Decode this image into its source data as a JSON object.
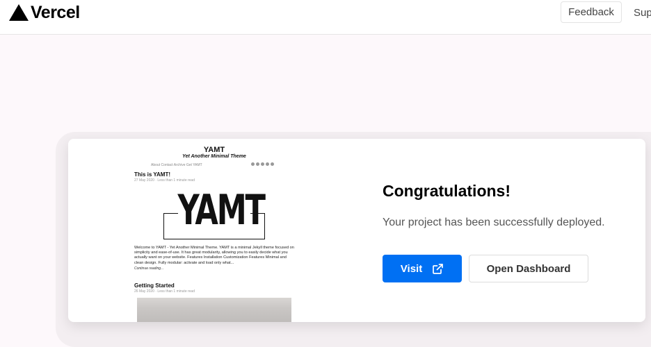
{
  "header": {
    "brand": "Vercel",
    "feedback_label": "Feedback",
    "support_label": "Sup"
  },
  "preview": {
    "site_title": "YAMT",
    "site_subtitle": "Yet Another Minimal Theme",
    "nav": "About  Contact  Archive  Get YAMT",
    "post1_title": "This is YAMT!",
    "post1_meta": "27 May 2020 · Less than 1 minute read",
    "logo_text": "YAMT",
    "post1_excerpt": "Welcome to YAMT - Yet Another Minimal Theme. YAMT is a minimal Jekyll theme focused on simplicity and ease-of-use. It has great modularity, allowing you to easily decide what you actually want on your website. Features Installation Customization Features Minimal and clean design. Fully modular: activate and load only what...",
    "continue_label": "Continue reading...",
    "post2_title": "Getting Started",
    "post2_meta": "26 May 2020 · Less than 1 minute read"
  },
  "main": {
    "heading": "Congratulations!",
    "message": "Your project has been successfully deployed.",
    "visit_label": "Visit",
    "dashboard_label": "Open Dashboard"
  },
  "colors": {
    "accent": "#0070f3",
    "background": "#fdf8fb"
  },
  "icons": {
    "logo": "vercel-triangle-icon",
    "visit": "external-link-icon"
  }
}
